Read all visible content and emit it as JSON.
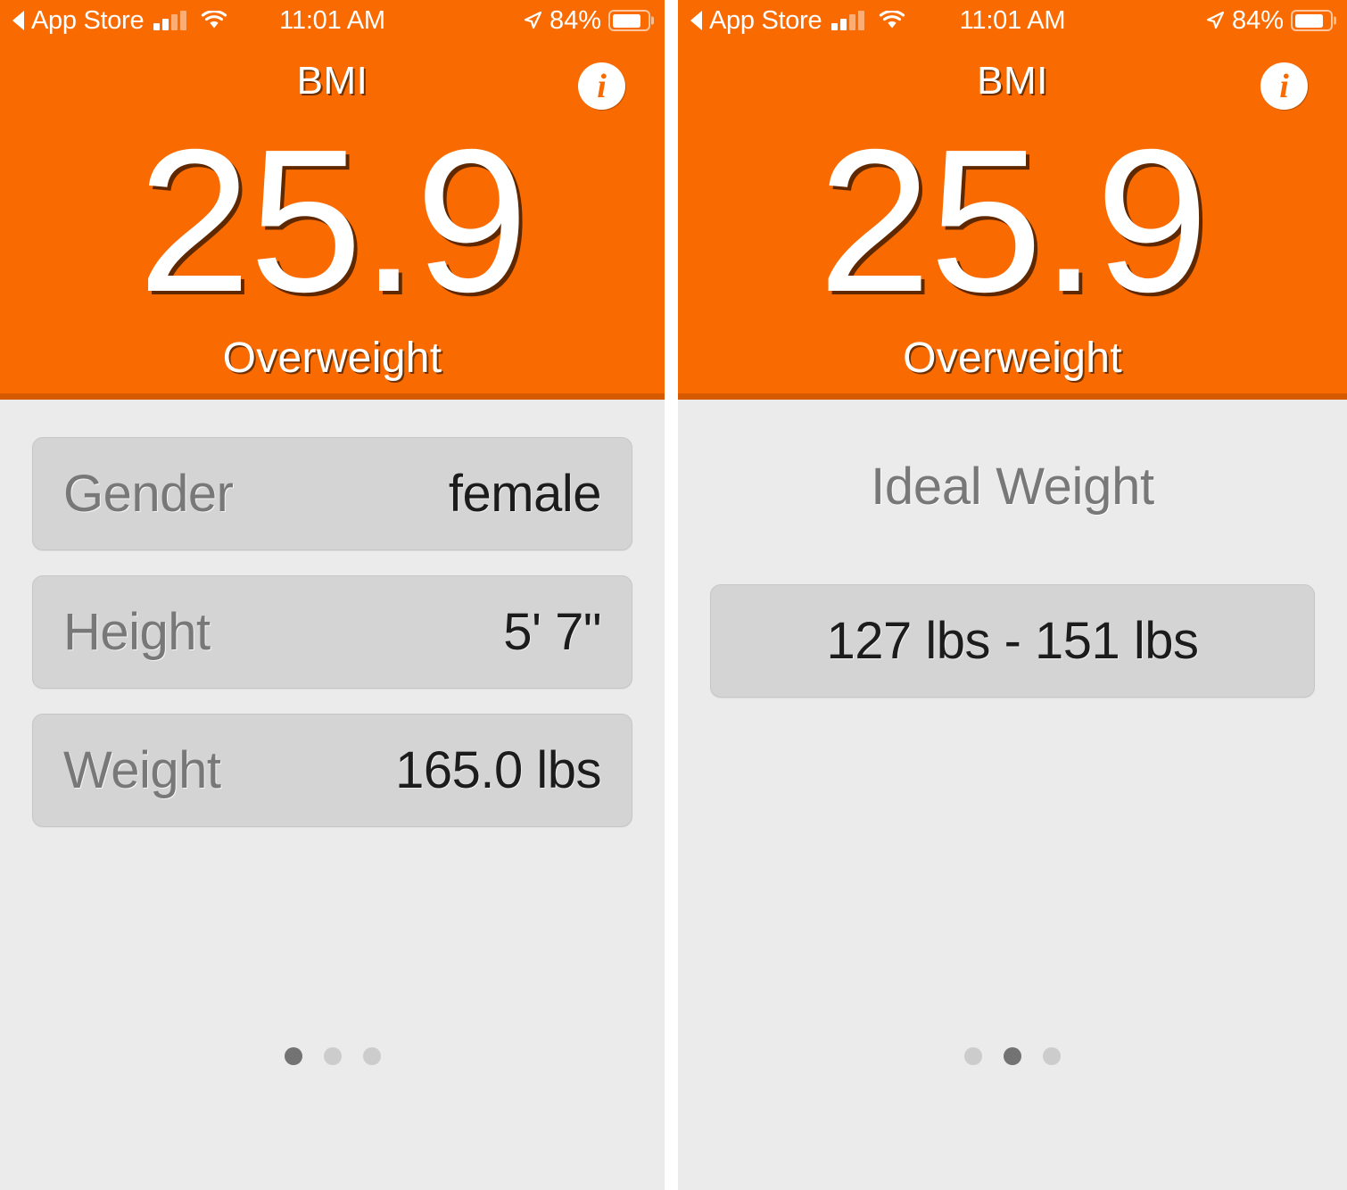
{
  "status_bar": {
    "back_label": "App Store",
    "back_arrow_icon": "triangle-left-icon",
    "signal_icon": "cellular-signal-icon",
    "signal_bars_filled": 2,
    "signal_bars_total": 4,
    "wifi_icon": "wifi-icon",
    "time": "11:01 AM",
    "location_icon": "location-arrow-icon",
    "battery_percent": "84%",
    "battery_level": 84,
    "battery_icon": "battery-icon"
  },
  "colors": {
    "accent_orange": "#F96A00",
    "accent_orange_dark": "#D65A00",
    "page_background": "#EBEBEB",
    "row_background": "#D4D4D4",
    "label_gray": "#787878",
    "value_dark": "#1C1C1C",
    "dot_active": "#737373",
    "dot_inactive": "#CCCCCC"
  },
  "screens": [
    {
      "header": {
        "title": "BMI",
        "info_icon": "info-circle-icon",
        "value": "25.9",
        "category": "Overweight"
      },
      "rows": [
        {
          "label": "Gender",
          "value": "female"
        },
        {
          "label": "Height",
          "value": "5' 7\""
        },
        {
          "label": "Weight",
          "value": "165.0 lbs"
        }
      ],
      "pagination": {
        "total": 3,
        "active": 0
      }
    },
    {
      "header": {
        "title": "BMI",
        "info_icon": "info-circle-icon",
        "value": "25.9",
        "category": "Overweight"
      },
      "heading": "Ideal Weight",
      "rows": [
        {
          "value": "127 lbs - 151 lbs"
        }
      ],
      "pagination": {
        "total": 3,
        "active": 1
      }
    }
  ]
}
